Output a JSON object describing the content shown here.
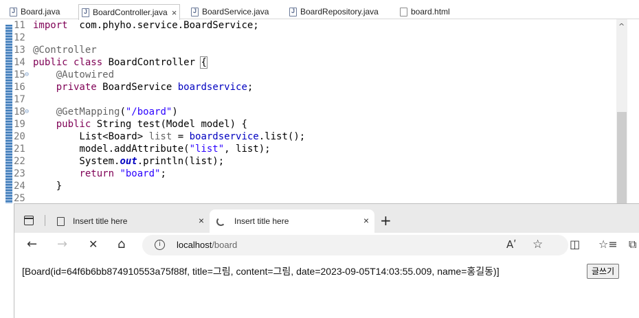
{
  "editor": {
    "tabs": [
      {
        "label": "Board.java"
      },
      {
        "label": "BoardController.java",
        "close": "×"
      },
      {
        "label": "BoardService.java"
      },
      {
        "label": "BoardRepository.java"
      },
      {
        "label": "board.html"
      }
    ],
    "lines": [
      {
        "num": "11",
        "parts": [
          [
            "kw",
            "import"
          ],
          [
            "",
            "  com.phyho.service.BoardService;"
          ]
        ]
      },
      {
        "num": "12",
        "parts": []
      },
      {
        "num": "13",
        "parts": [
          [
            "ann",
            "@Controller"
          ]
        ]
      },
      {
        "num": "14",
        "parts": [
          [
            "kw",
            "public"
          ],
          [
            "",
            " "
          ],
          [
            "kw",
            "class"
          ],
          [
            "",
            " BoardController "
          ],
          [
            "bracket",
            "{"
          ]
        ]
      },
      {
        "num": "15",
        "fold": true,
        "parts": [
          [
            "",
            "    "
          ],
          [
            "ann",
            "@Autowired"
          ]
        ]
      },
      {
        "num": "16",
        "parts": [
          [
            "",
            "    "
          ],
          [
            "kw",
            "private"
          ],
          [
            "",
            " BoardService "
          ],
          [
            "fld",
            "boardservice"
          ],
          [
            "",
            ";"
          ]
        ]
      },
      {
        "num": "17",
        "parts": []
      },
      {
        "num": "18",
        "fold": true,
        "parts": [
          [
            "",
            "    "
          ],
          [
            "ann",
            "@GetMapping"
          ],
          [
            "",
            "("
          ],
          [
            "str",
            "\"/board\""
          ],
          [
            "",
            ")"
          ]
        ]
      },
      {
        "num": "19",
        "parts": [
          [
            "",
            "    "
          ],
          [
            "kw",
            "public"
          ],
          [
            "",
            " String test(Model model) {"
          ]
        ]
      },
      {
        "num": "20",
        "parts": [
          [
            "",
            "        List<Board> "
          ],
          [
            "ann",
            "list"
          ],
          [
            "",
            " = "
          ],
          [
            "fld",
            "boardservice"
          ],
          [
            "",
            ".list();"
          ]
        ]
      },
      {
        "num": "21",
        "parts": [
          [
            "",
            "        model.addAttribute("
          ],
          [
            "str",
            "\"list\""
          ],
          [
            "",
            ", list);"
          ]
        ]
      },
      {
        "num": "22",
        "parts": [
          [
            "",
            "        System."
          ],
          [
            "stat",
            "out"
          ],
          [
            "",
            ".println(list);"
          ]
        ]
      },
      {
        "num": "23",
        "parts": [
          [
            "",
            "        "
          ],
          [
            "kw",
            "return"
          ],
          [
            "",
            " "
          ],
          [
            "str",
            "\"board\""
          ],
          [
            "",
            ";"
          ]
        ]
      },
      {
        "num": "24",
        "parts": [
          [
            "",
            "    }"
          ]
        ]
      },
      {
        "num": "25",
        "parts": []
      }
    ]
  },
  "browser": {
    "tabs": [
      {
        "label": "Insert title here",
        "close": "×"
      },
      {
        "label": "Insert title here",
        "close": "×"
      }
    ],
    "new_tab": "+",
    "nav": {
      "back": "←",
      "forward": "→",
      "stop": "✕",
      "home": "⌂"
    },
    "url_host": "localhost",
    "url_path": "/board",
    "info_icon": "i",
    "read_aloud": "Aʹ",
    "favorite": "☆",
    "split": "◫",
    "favorites_bar": "☆≡",
    "collections": "⧉"
  },
  "page": {
    "output": "[Board(id=64f6b6bb874910553a75f88f, title=그림, content=그림, date=2023-09-05T14:03:55.009, name=홍길동)]",
    "write_button": "글쓰기"
  }
}
